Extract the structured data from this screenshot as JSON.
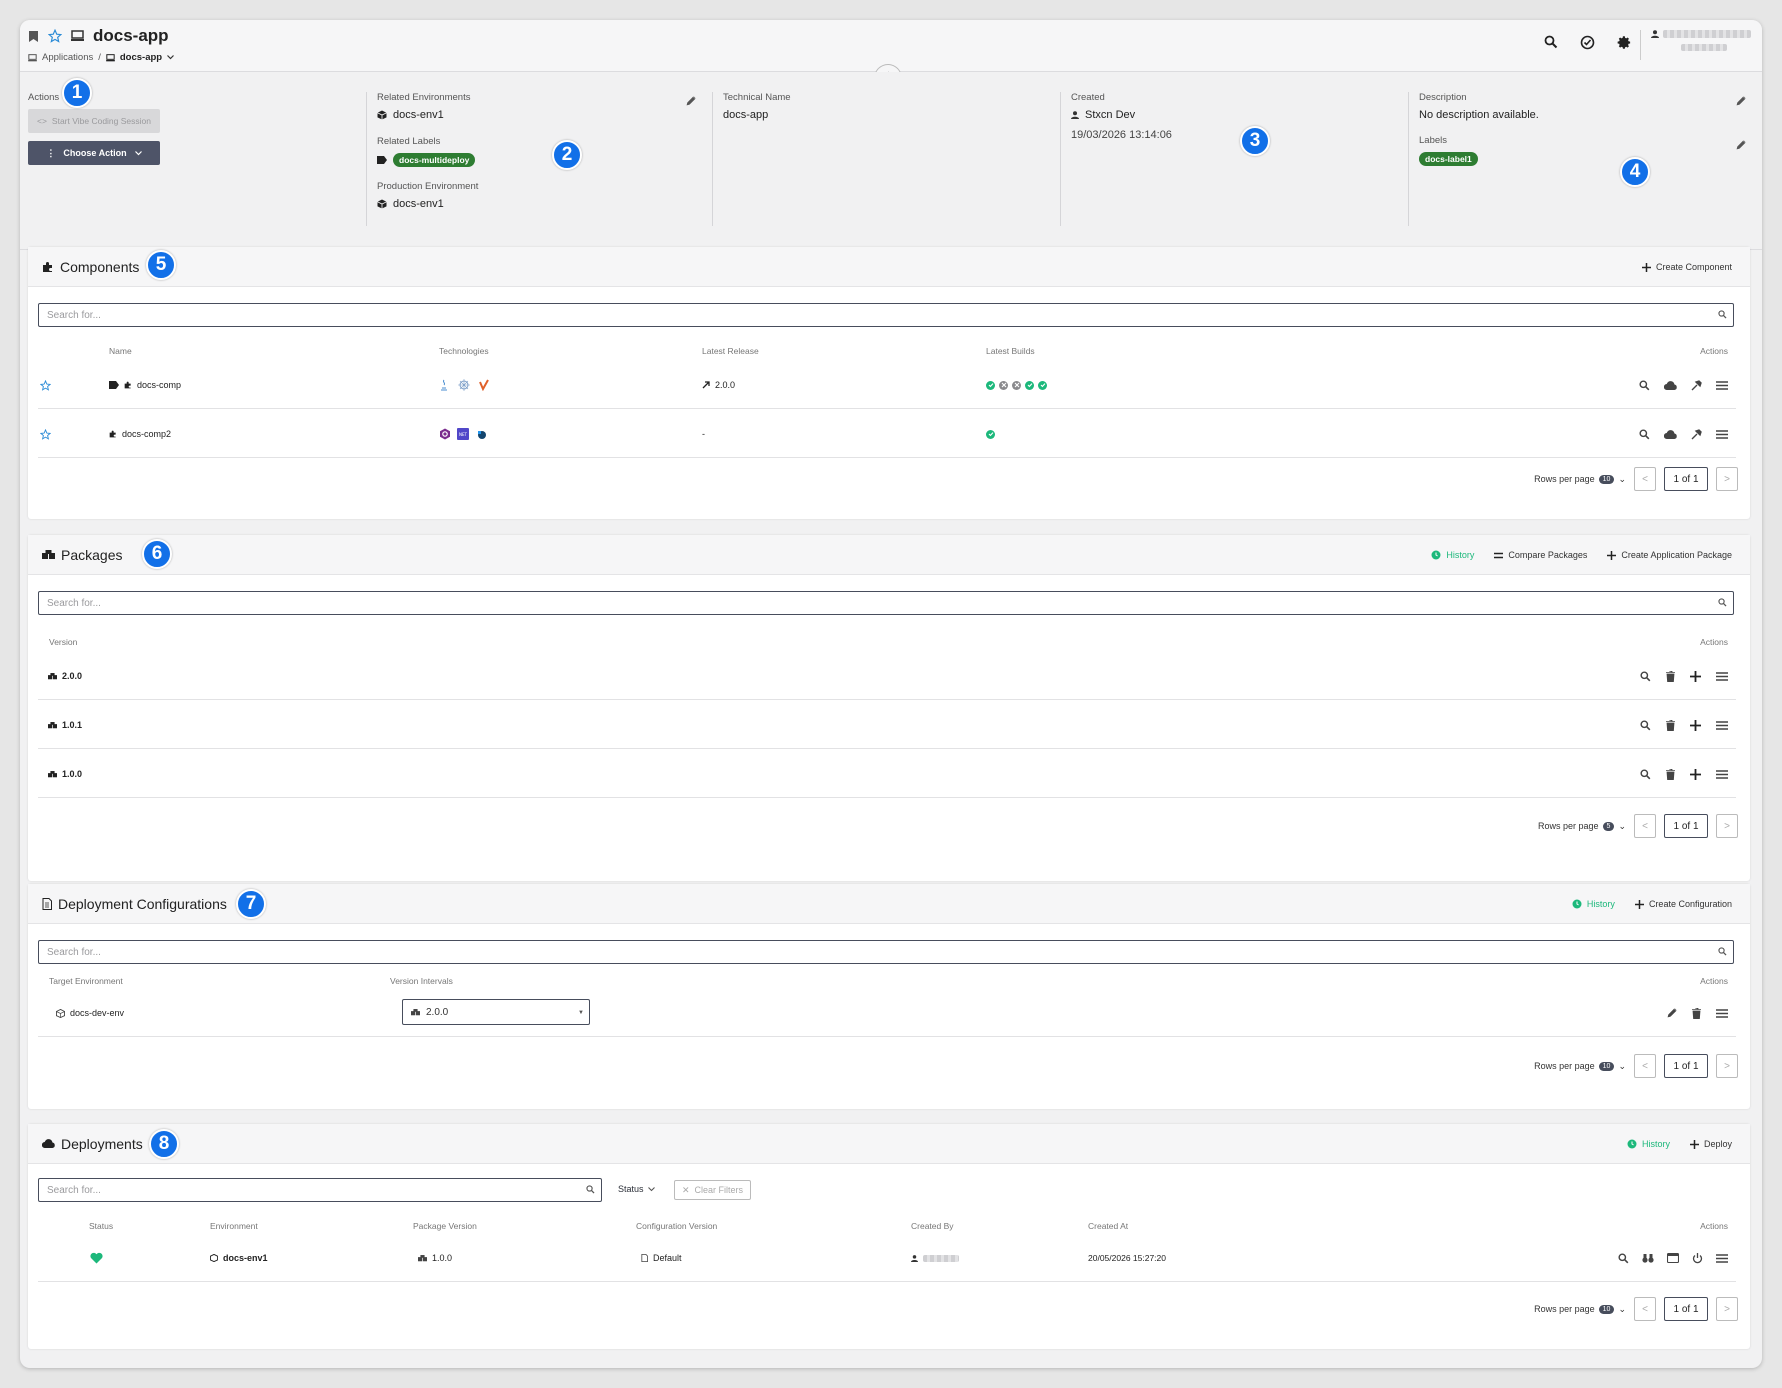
{
  "header": {
    "app_title": "docs-app",
    "breadcrumb_root": "Applications",
    "breadcrumb_sep": "/",
    "breadcrumb_current": "docs-app"
  },
  "info": {
    "actions_label": "Actions",
    "vibe_button": "Start Vibe Coding Session",
    "choose_action": "Choose Action",
    "related_envs_label": "Related Environments",
    "related_env_value": "docs-env1",
    "related_labels_label": "Related Labels",
    "related_label_value": "docs-multideploy",
    "prod_env_label": "Production Environment",
    "prod_env_value": "docs-env1",
    "tech_name_label": "Technical Name",
    "tech_name_value": "docs-app",
    "created_label": "Created",
    "created_by": "Stxcn Dev",
    "created_at": "19/03/2026 13:14:06",
    "description_label": "Description",
    "description_value": "No description available.",
    "labels_label": "Labels",
    "label_value": "docs-label1"
  },
  "callouts": [
    "1",
    "2",
    "3",
    "4",
    "5",
    "6",
    "7",
    "8"
  ],
  "components": {
    "title": "Components",
    "create": "Create Component",
    "search_placeholder": "Search for...",
    "columns": {
      "name": "Name",
      "technologies": "Technologies",
      "latest_release": "Latest Release",
      "latest_builds": "Latest Builds",
      "actions": "Actions"
    },
    "rows": [
      {
        "name": "docs-comp",
        "release": "2.0.0",
        "builds": [
          "success",
          "failed",
          "failed",
          "success",
          "success"
        ]
      },
      {
        "name": "docs-comp2",
        "release": "-",
        "builds": [
          "success"
        ]
      }
    ],
    "pager": {
      "rows_per_page": "Rows per page",
      "rows_count": "10",
      "page": "1 of 1",
      "prev": "<",
      "next": ">"
    }
  },
  "packages": {
    "title": "Packages",
    "history": "History",
    "compare": "Compare Packages",
    "create": "Create Application Package",
    "search_placeholder": "Search for...",
    "columns": {
      "version": "Version",
      "actions": "Actions"
    },
    "rows": [
      {
        "version": "2.0.0"
      },
      {
        "version": "1.0.1"
      },
      {
        "version": "1.0.0"
      }
    ],
    "pager": {
      "rows_per_page": "Rows per page",
      "rows_count": "5",
      "page": "1 of 1",
      "prev": "<",
      "next": ">"
    }
  },
  "deploy_configs": {
    "title": "Deployment Configurations",
    "history": "History",
    "create": "Create Configuration",
    "search_placeholder": "Search for...",
    "columns": {
      "target_env": "Target Environment",
      "version_intervals": "Version Intervals",
      "actions": "Actions"
    },
    "rows": [
      {
        "env": "docs-dev-env",
        "version": "2.0.0"
      }
    ],
    "pager": {
      "rows_per_page": "Rows per page",
      "rows_count": "10",
      "page": "1 of 1",
      "prev": "<",
      "next": ">"
    }
  },
  "deployments": {
    "title": "Deployments",
    "history": "History",
    "deploy": "Deploy",
    "search_placeholder": "Search for...",
    "status_filter": "Status",
    "clear_filters": "Clear Filters",
    "columns": {
      "status": "Status",
      "environment": "Environment",
      "package_version": "Package Version",
      "config_version": "Configuration Version",
      "created_by": "Created By",
      "created_at": "Created At",
      "actions": "Actions"
    },
    "rows": [
      {
        "environment": "docs-env1",
        "package_version": "1.0.0",
        "config_version": "Default",
        "created_at": "20/05/2026 15:27:20"
      }
    ],
    "pager": {
      "rows_per_page": "Rows per page",
      "rows_count": "10",
      "page": "1 of 1",
      "prev": "<",
      "next": ">"
    }
  },
  "colors": {
    "accent_green": "#1cb87b",
    "label_green": "#2e7d32",
    "primary_dark": "#4e5468",
    "callout_blue": "#1270e8",
    "fail_grey": "#8a8a8d"
  }
}
